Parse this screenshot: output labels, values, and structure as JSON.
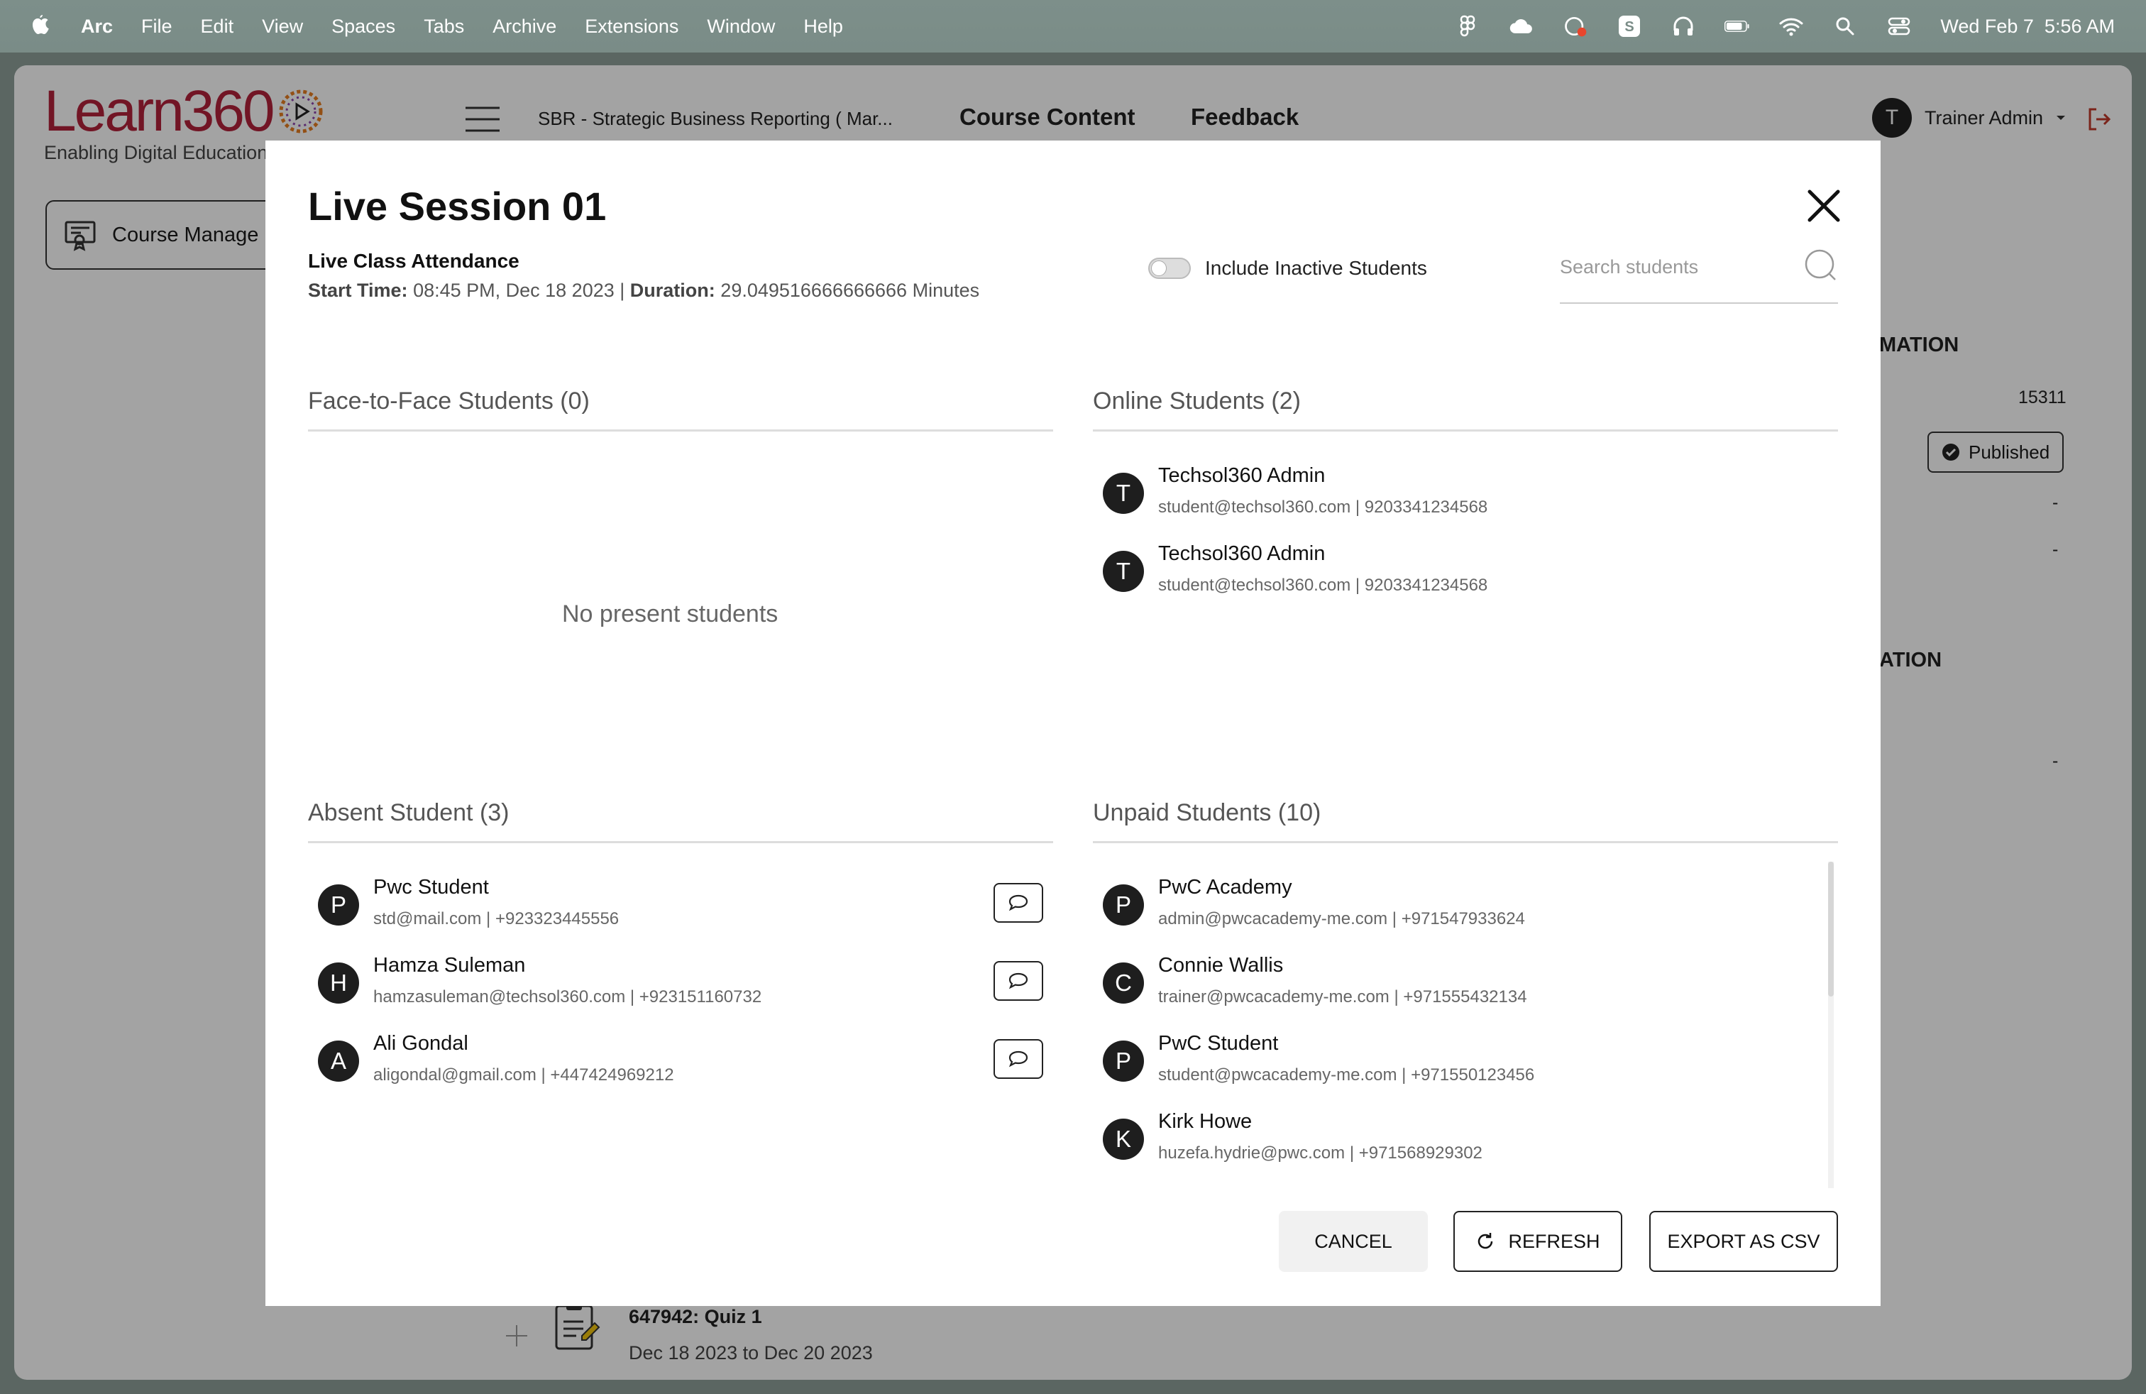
{
  "menubar": {
    "app": "Arc",
    "items": [
      "File",
      "Edit",
      "View",
      "Spaces",
      "Tabs",
      "Archive",
      "Extensions",
      "Window",
      "Help"
    ],
    "clock": "Wed Feb 7  5:56 AM"
  },
  "header": {
    "logo_text": "Learn360",
    "tagline": "Enabling Digital Education",
    "course_title": "SBR - Strategic Business Reporting ( Mar...",
    "tabs": [
      "Course Content",
      "Feedback"
    ],
    "user_initial": "T",
    "user_name": "Trainer Admin"
  },
  "sidebar": {
    "course_manage_label": "Course Manage"
  },
  "background": {
    "info_title_1": "MATION",
    "info_value_id": "15311",
    "status_badge": "Published",
    "dash_1": "-",
    "dash_2": "-",
    "info_title_2": "ATION",
    "dash_3": "-",
    "quiz_title": "647942: Quiz 1",
    "quiz_dates": "Dec 18 2023 to Dec 20 2023"
  },
  "modal": {
    "title": "Live Session 01",
    "subtitle": "Live Class Attendance",
    "start_label": "Start Time:",
    "start_value": "08:45 PM, Dec 18 2023",
    "separator": "|",
    "duration_label": "Duration:",
    "duration_value": "29.049516666666666 Minutes",
    "toggle_label": "Include Inactive Students",
    "search_placeholder": "Search students",
    "face_to_face": {
      "title": "Face-to-Face Students (0)",
      "empty": "No present students"
    },
    "online": {
      "title": "Online Students (2)",
      "students": [
        {
          "initial": "T",
          "name": "Techsol360 Admin",
          "contact": "student@techsol360.com | 9203341234568"
        },
        {
          "initial": "T",
          "name": "Techsol360 Admin",
          "contact": "student@techsol360.com | 9203341234568"
        }
      ]
    },
    "absent": {
      "title": "Absent Student (3)",
      "students": [
        {
          "initial": "P",
          "name": "Pwc Student",
          "contact": "std@mail.com | +923323445556"
        },
        {
          "initial": "H",
          "name": "Hamza Suleman",
          "contact": "hamzasuleman@techsol360.com | +923151160732"
        },
        {
          "initial": "A",
          "name": "Ali Gondal",
          "contact": "aligondal@gmail.com | +447424969212"
        }
      ]
    },
    "unpaid": {
      "title": "Unpaid Students (10)",
      "students": [
        {
          "initial": "P",
          "name": "PwC Academy",
          "contact": "admin@pwcacademy-me.com | +971547933624"
        },
        {
          "initial": "C",
          "name": "Connie Wallis",
          "contact": "trainer@pwcacademy-me.com | +971555432134"
        },
        {
          "initial": "P",
          "name": "PwC Student",
          "contact": "student@pwcacademy-me.com | +971550123456"
        },
        {
          "initial": "K",
          "name": "Kirk Howe",
          "contact": "huzefa.hydrie@pwc.com | +971568929302"
        }
      ]
    },
    "buttons": {
      "cancel": "CANCEL",
      "refresh": "REFRESH",
      "export": "EXPORT AS CSV"
    }
  }
}
